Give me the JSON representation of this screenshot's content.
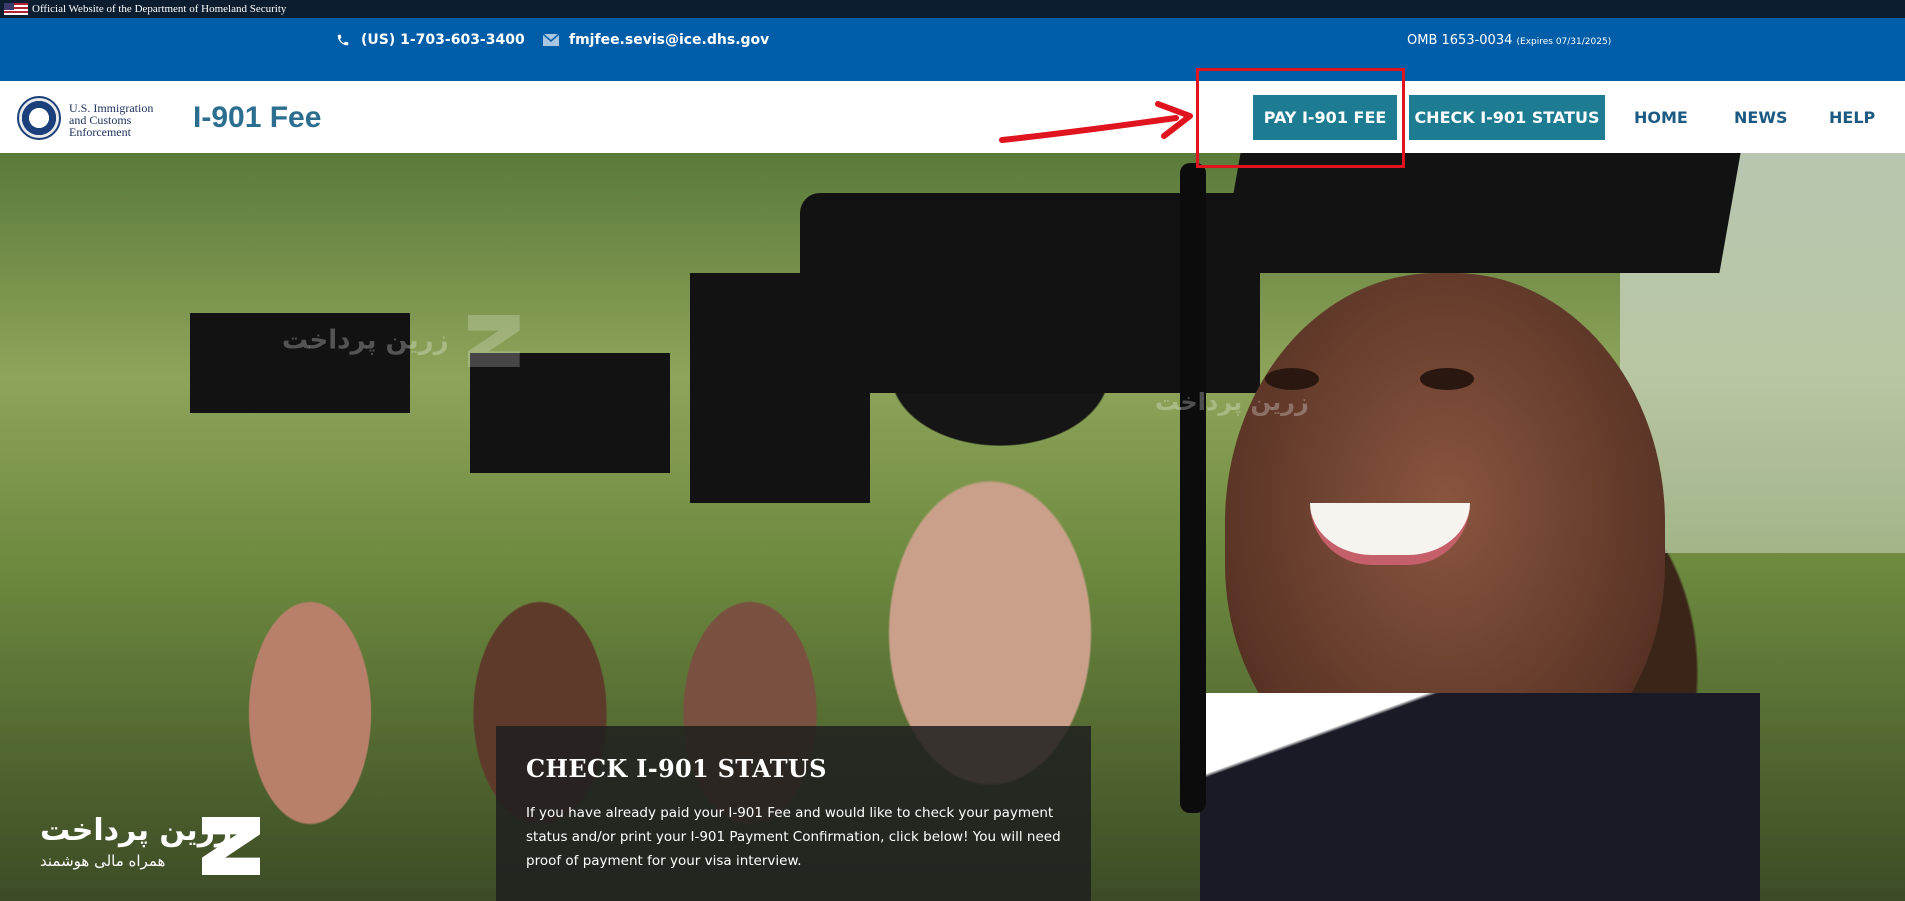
{
  "gov_banner": {
    "text": "Official Website of the Department of Homeland Security"
  },
  "contact": {
    "phone": "(US) 1-703-603-3400",
    "email": "fmjfee.sevis@ice.dhs.gov",
    "omb_main": "OMB 1653-0034",
    "omb_expires": "(Expires 07/31/2025)"
  },
  "header": {
    "agency_line1": "U.S. Immigration",
    "agency_line2": "and Customs",
    "agency_line3": "Enforcement",
    "site_title": "I-901 Fee"
  },
  "nav": {
    "pay_label": "PAY I-901 FEE",
    "check_label": "CHECK I-901 STATUS",
    "home_label": "HOME",
    "news_label": "NEWS",
    "help_label": "HELP"
  },
  "hero": {
    "card_title": "CHECK I-901 STATUS",
    "card_text": "If you have already paid your I-901 Fee and would like to check your payment status and/or print your I-901 Payment Confirmation, click below! You will need proof of payment for your visa interview."
  },
  "watermark": {
    "brand": "زرین پرداخت",
    "tagline": "همراه مالی هوشمند"
  },
  "colors": {
    "contact_bar": "#005ea8",
    "nav_button": "#1d7c91",
    "nav_link": "#1d5a83",
    "annotation": "#e0141e"
  },
  "icons": [
    "flag-icon",
    "phone-icon",
    "mail-icon",
    "dhs-seal-icon",
    "arrow-annotation-icon"
  ]
}
